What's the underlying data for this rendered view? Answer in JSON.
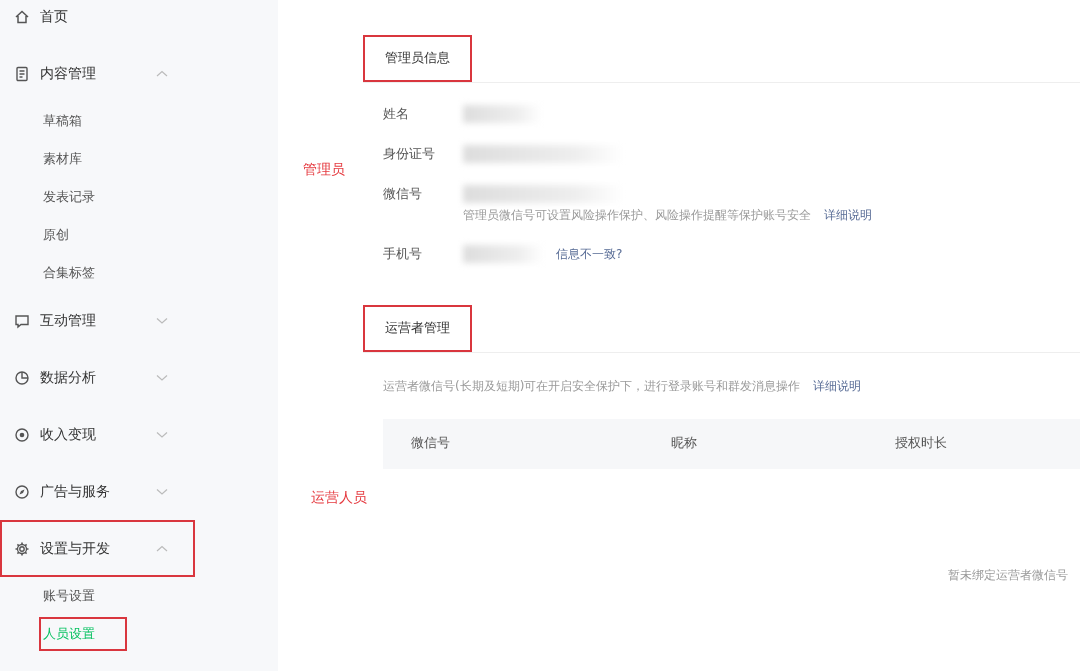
{
  "sidebar": {
    "items": [
      {
        "label": "首页",
        "highlighted": false
      },
      {
        "label": "内容管理",
        "expanded": true,
        "highlighted": false,
        "children": [
          {
            "label": "草稿箱",
            "selected": false,
            "highlighted": false
          },
          {
            "label": "素材库",
            "selected": false,
            "highlighted": false
          },
          {
            "label": "发表记录",
            "selected": false,
            "highlighted": false
          },
          {
            "label": "原创",
            "selected": false,
            "highlighted": false
          },
          {
            "label": "合集标签",
            "selected": false,
            "highlighted": false
          }
        ]
      },
      {
        "label": "互动管理",
        "expanded": false,
        "highlighted": false
      },
      {
        "label": "数据分析",
        "expanded": false,
        "highlighted": false
      },
      {
        "label": "收入变现",
        "expanded": false,
        "highlighted": false
      },
      {
        "label": "广告与服务",
        "expanded": false,
        "highlighted": false
      },
      {
        "label": "设置与开发",
        "expanded": true,
        "highlighted": true,
        "children": [
          {
            "label": "账号设置",
            "selected": false,
            "highlighted": false
          },
          {
            "label": "人员设置",
            "selected": true,
            "highlighted": true
          }
        ]
      }
    ]
  },
  "admin_section": {
    "title": "管理员信息",
    "highlighted": true,
    "annotation": "管理员",
    "fields": [
      {
        "label": "姓名",
        "kind": "short"
      },
      {
        "label": "身份证号",
        "kind": "long"
      },
      {
        "label": "微信号",
        "kind": "long",
        "hint": "管理员微信号可设置风险操作保护、风险操作提醒等保护账号安全",
        "link": "详细说明"
      },
      {
        "label": "手机号",
        "kind": "phone",
        "link": "信息不一致?"
      }
    ]
  },
  "operator_section": {
    "title": "运营者管理",
    "highlighted": true,
    "annotation": "运营人员",
    "description": "运营者微信号(长期及短期)可在开启安全保护下，进行登录账号和群发消息操作",
    "link": "详细说明",
    "table": {
      "columns": [
        "微信号",
        "昵称",
        "授权时长"
      ],
      "empty_text": "暂未绑定运营者微信号"
    }
  }
}
